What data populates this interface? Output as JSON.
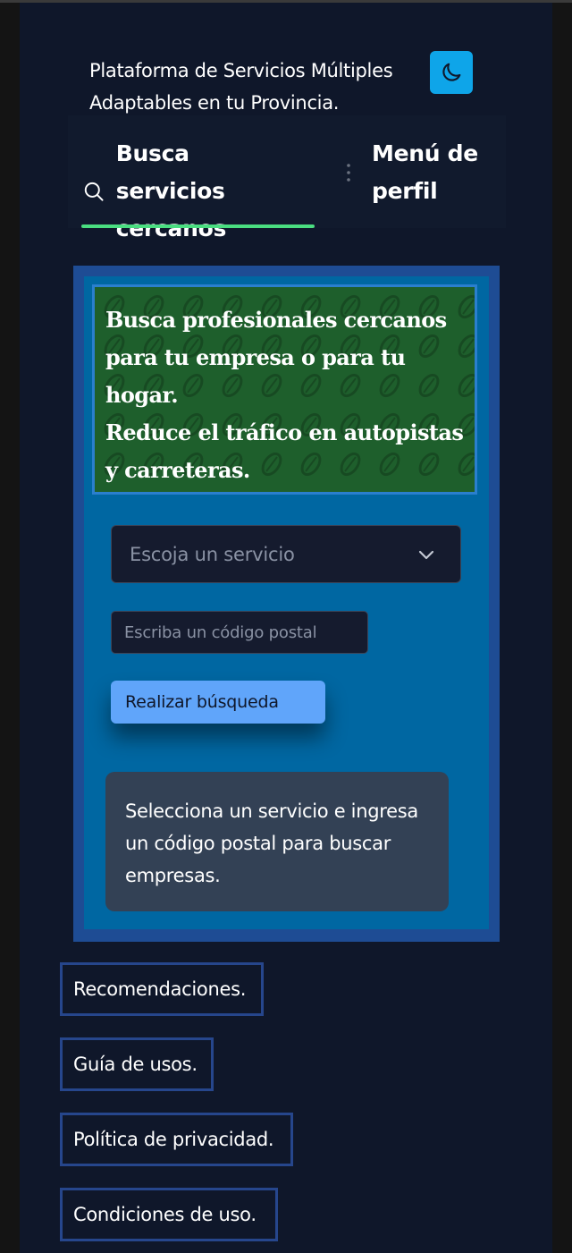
{
  "header": {
    "title": "Plataforma de Servicios Múltiples Adaptables en tu Provincia.",
    "theme_icon": "moon-icon",
    "theme_color": "#0ea5e9"
  },
  "nav": {
    "tabs": [
      {
        "label": "Busca servicios cercanos",
        "icon": "search-icon",
        "active": true
      },
      {
        "label": "Menú de perfil",
        "icon": "kebab-menu-icon",
        "active": false
      }
    ],
    "active_color": "#4ade80"
  },
  "banner": {
    "line1": "Busca profesionales cercanos para tu empresa o para tu hogar.",
    "line2": "Reduce el tráfico en autopistas y carreteras.",
    "background_color": "#1e5f2c"
  },
  "form": {
    "service_select": {
      "placeholder": "Escoja un servicio",
      "icon": "chevron-down-icon"
    },
    "postal_input": {
      "placeholder": "Escriba un código postal",
      "value": ""
    },
    "submit_label": "Realizar búsqueda",
    "submit_color": "#60a5fa"
  },
  "info": {
    "message": "Selecciona un servicio e ingresa un código postal para buscar empresas."
  },
  "footer": {
    "links": [
      {
        "label": "Recomendaciones."
      },
      {
        "label": "Guía de usos."
      },
      {
        "label": "Política de privacidad."
      },
      {
        "label": "Condiciones de uso."
      }
    ]
  }
}
